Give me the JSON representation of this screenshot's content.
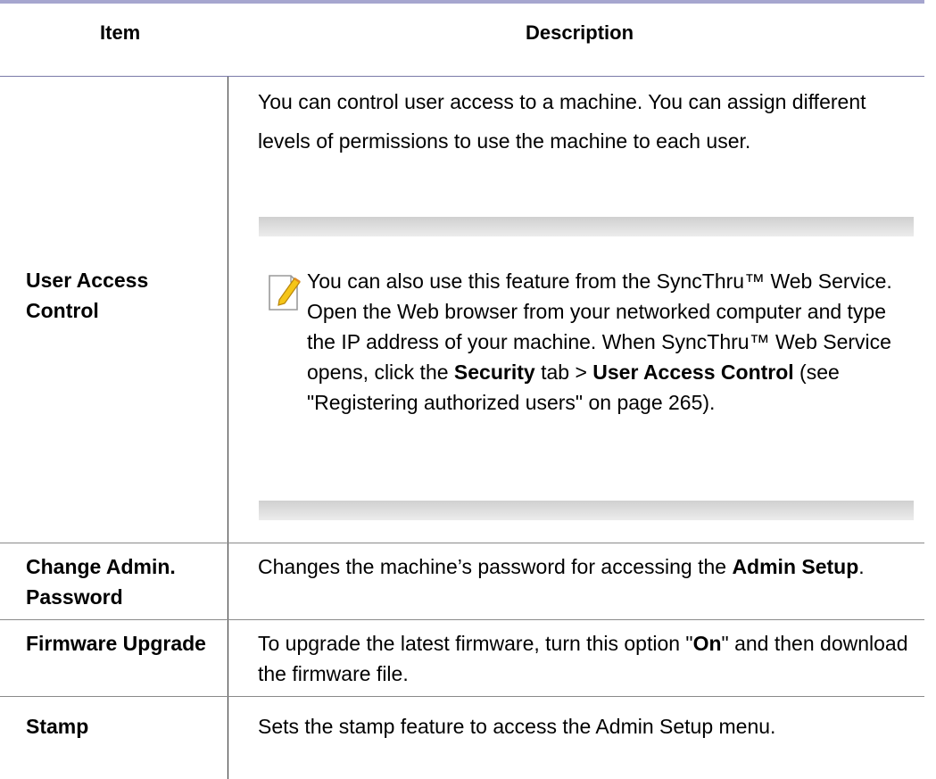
{
  "table": {
    "headers": {
      "item": "Item",
      "description": "Description"
    },
    "rows": [
      {
        "item": "User Access Control",
        "description": "You can control user access to a machine. You can assign different levels of permissions to use the machine to each user.",
        "note": {
          "icon": "note-icon",
          "text_1": "You can also use this feature from the SyncThru™ Web Service. Open the Web browser from your networked computer and type the IP address of your machine. When SyncThru™ Web Service opens, click the ",
          "bold_1": "Security",
          "text_2": " tab > ",
          "bold_2": "User Access Control",
          "text_3": " (see \"Registering authorized users\" on page 265)."
        }
      },
      {
        "item": "Change Admin. Password",
        "description_1": "Changes the machine’s password for accessing the ",
        "description_bold": "Admin Setup",
        "description_2": "."
      },
      {
        "item": "Firmware Upgrade",
        "description_1": "To upgrade the latest firmware, turn this option \"",
        "description_bold": "On",
        "description_2": "\" and then download the firmware file."
      },
      {
        "item": "Stamp",
        "description": "Sets the stamp feature to access the Admin Setup menu."
      }
    ]
  },
  "colors": {
    "header_rule": "#a6a6cf",
    "note_band": "#d0d0d0",
    "icon_accent": "#f5c518"
  }
}
